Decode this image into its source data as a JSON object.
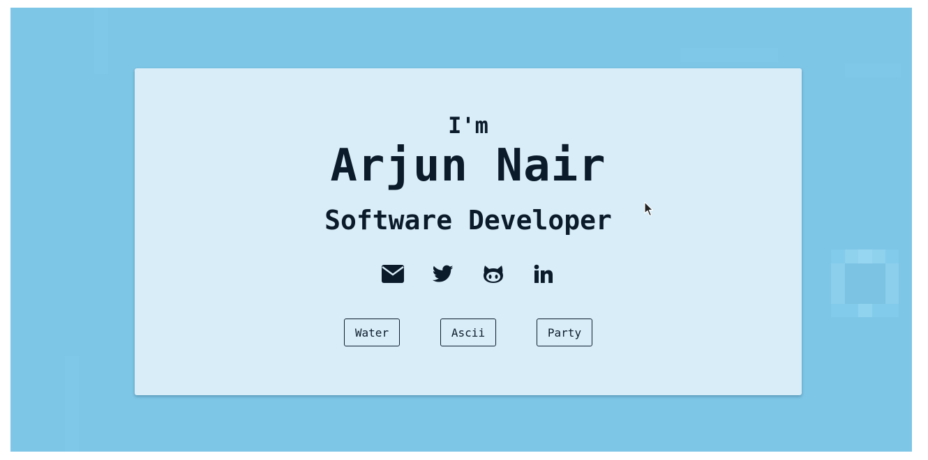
{
  "colors": {
    "background": "#7ec6e6",
    "card": "#d8edf8",
    "text": "#0c1b2a"
  },
  "hero": {
    "intro": "I'm",
    "name": "Arjun Nair",
    "role": "Software Developer"
  },
  "socials": [
    {
      "icon": "envelope-icon",
      "label": "Email"
    },
    {
      "icon": "twitter-icon",
      "label": "Twitter"
    },
    {
      "icon": "github-icon",
      "label": "GitHub"
    },
    {
      "icon": "linkedin-icon",
      "label": "LinkedIn"
    }
  ],
  "themes": {
    "water": "Water",
    "ascii": "Ascii",
    "party": "Party"
  }
}
